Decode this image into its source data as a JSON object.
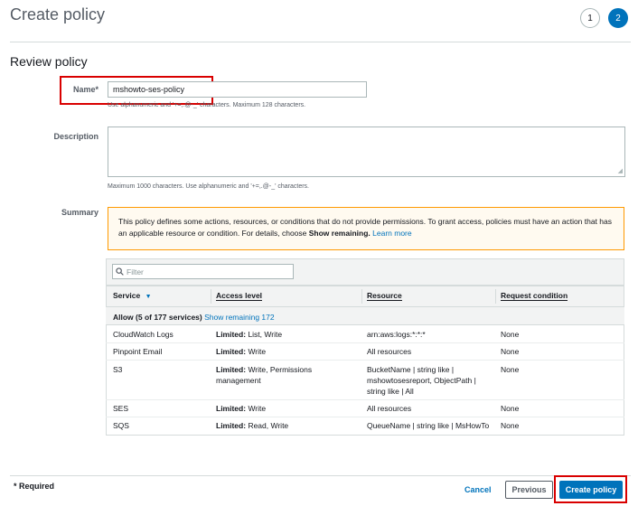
{
  "header": {
    "title": "Create policy",
    "steps": [
      "1",
      "2"
    ],
    "active_step": "2"
  },
  "section_title": "Review policy",
  "form": {
    "name_label": "Name*",
    "name_value": "mshowto-ses-policy",
    "name_hint": "Use alphanumeric and '+=,.@-_' characters. Maximum 128 characters.",
    "description_label": "Description",
    "description_value": "",
    "description_hint": "Maximum 1000 characters. Use alphanumeric and '+=,.@-_' characters.",
    "summary_label": "Summary"
  },
  "notice": {
    "text": "This policy defines some actions, resources, or conditions that do not provide permissions. To grant access, policies must have an action that has an applicable resource or condition. For details, choose",
    "bold": "Show remaining.",
    "link": "Learn more"
  },
  "table": {
    "filter_placeholder": "Filter",
    "columns": [
      "Service",
      "Access level",
      "Resource",
      "Request condition"
    ],
    "group_label": "Allow (5 of 177 services)",
    "group_link": "Show remaining 172",
    "rows": [
      {
        "service": "CloudWatch Logs",
        "access_bold": "Limited:",
        "access_rest": "List, Write",
        "resource": "arn:aws:logs:*:*:*",
        "condition": "None"
      },
      {
        "service": "Pinpoint Email",
        "access_bold": "Limited:",
        "access_rest": "Write",
        "resource": "All resources",
        "condition": "None"
      },
      {
        "service": "S3",
        "access_bold": "Limited:",
        "access_rest": "Write, Permissions management",
        "resource": "BucketName | string like | mshowtosesreport, ObjectPath | string like | All",
        "condition": "None"
      },
      {
        "service": "SES",
        "access_bold": "Limited:",
        "access_rest": "Write",
        "resource": "All resources",
        "condition": "None"
      },
      {
        "service": "SQS",
        "access_bold": "Limited:",
        "access_rest": "Read, Write",
        "resource": "QueueName | string like | MsHowTo",
        "condition": "None"
      }
    ]
  },
  "footer": {
    "required": "* Required",
    "cancel": "Cancel",
    "previous": "Previous",
    "create": "Create policy"
  },
  "colors": {
    "accent": "#0073bb",
    "highlight": "#d90000",
    "warning_border": "#ff9900"
  }
}
